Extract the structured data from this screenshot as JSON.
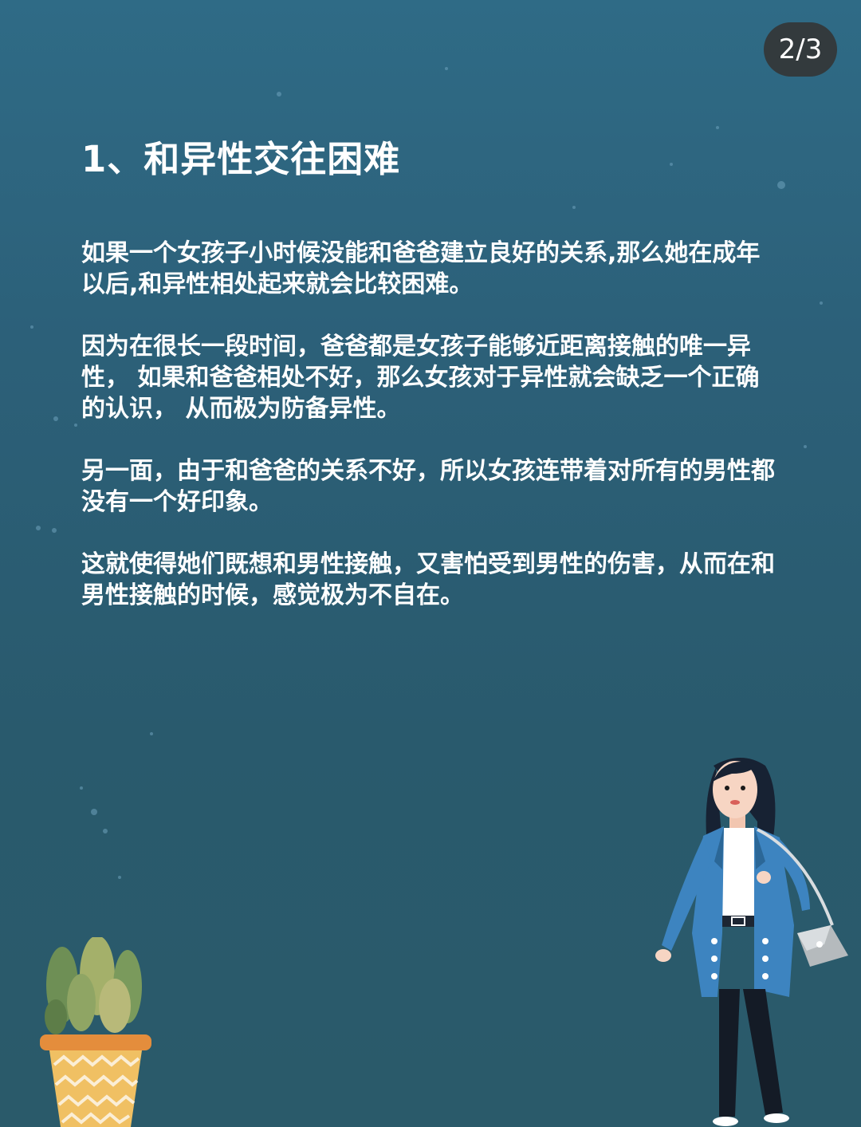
{
  "page_counter": "2/3",
  "article": {
    "heading": "1、和异性交往困难",
    "paragraphs": [
      "如果一个女孩子小时候没能和爸爸建立良好的关系,那么她在成年以后,和异性相处起来就会比较困难。",
      "因为在很长一段时间，爸爸都是女孩子能够近距离接触的唯一异性， 如果和爸爸相处不好，那么女孩对于异性就会缺乏一个正确的认识， 从而极为防备异性。",
      "另一面，由于和爸爸的关系不好，所以女孩连带着对所有的男性都没有一个好印象。",
      "这就使得她们既想和男性接触，又害怕受到男性的伤害，从而在和男性接触的时候，感觉极为不自在。"
    ]
  },
  "colors": {
    "background_top": "#2f6b86",
    "background_bottom": "#2a5a6a",
    "text": "#ffffff",
    "counter_bg": "#333a3d"
  },
  "illustrations": {
    "plant": "potted-plant-illustration",
    "woman": "woman-with-handbag-illustration"
  }
}
